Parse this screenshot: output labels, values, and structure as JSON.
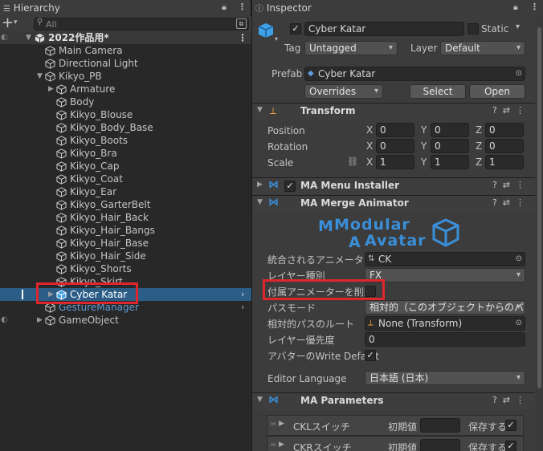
{
  "hierarchy": {
    "tab_label": "Hierarchy",
    "search_placeholder": "All",
    "scene_name": "2022作品用*",
    "items": [
      {
        "label": "Main Camera"
      },
      {
        "label": "Directional Light"
      },
      {
        "label": "Kikyo_PB"
      },
      {
        "label": "Armature"
      },
      {
        "label": "Body"
      },
      {
        "label": "Kikyo_Blouse"
      },
      {
        "label": "Kikyo_Body_Base"
      },
      {
        "label": "Kikyo_Boots"
      },
      {
        "label": "Kikyo_Bra"
      },
      {
        "label": "Kikyo_Cap"
      },
      {
        "label": "Kikyo_Coat"
      },
      {
        "label": "Kikyo_Ear"
      },
      {
        "label": "Kikyo_GarterBelt"
      },
      {
        "label": "Kikyo_Hair_Back"
      },
      {
        "label": "Kikyo_Hair_Bangs"
      },
      {
        "label": "Kikyo_Hair_Base"
      },
      {
        "label": "Kikyo_Hair_Side"
      },
      {
        "label": "Kikyo_Shorts"
      },
      {
        "label": "Kikyo_Skirt"
      },
      {
        "label": "Cyber Katar"
      },
      {
        "label": "GestureManager"
      },
      {
        "label": "GameObject"
      }
    ]
  },
  "inspector": {
    "tab_label": "Inspector",
    "object_name": "Cyber Katar",
    "static_label": "Static",
    "tag_label": "Tag",
    "tag_value": "Untagged",
    "layer_label": "Layer",
    "layer_value": "Default",
    "prefab_label": "Prefab",
    "prefab_value": "Cyber Katar",
    "overrides_label": "Overrides",
    "select_label": "Select",
    "open_label": "Open",
    "transform": {
      "title": "Transform",
      "position_label": "Position",
      "rotation_label": "Rotation",
      "scale_label": "Scale",
      "position": {
        "x": "0",
        "y": "0",
        "z": "0"
      },
      "rotation": {
        "x": "0",
        "y": "0",
        "z": "0"
      },
      "scale": {
        "x": "1",
        "y": "1",
        "z": "1"
      },
      "axis_x": "X",
      "axis_y": "Y",
      "axis_z": "Z"
    },
    "menu_installer": {
      "title": "MA Menu Installer"
    },
    "merge_animator": {
      "title": "MA Merge Animator",
      "logo_line1": "Modular",
      "logo_line2": "Avatar",
      "animator_label": "統合されるアニメーター",
      "animator_value": "CK",
      "layer_type_label": "レイヤー種別",
      "layer_type_value": "FX",
      "delete_attached_label": "付属アニメーターを削除",
      "path_mode_label": "パスモード",
      "path_mode_value": "相対的（このオブジェクトからのパスを依存",
      "relative_root_label": "相対的パスのルート",
      "relative_root_value": "None (Transform)",
      "layer_priority_label": "レイヤー優先度",
      "layer_priority_value": "0",
      "write_defaults_label": "アバターのWrite Default",
      "editor_language_label": "Editor Language",
      "editor_language_value": "日本語 (日本)"
    },
    "parameters": {
      "title": "MA Parameters",
      "rows": [
        {
          "name": "CKLスイッチ",
          "default_label": "初期値",
          "saved_label": "保存する"
        },
        {
          "name": "CKRスイッチ",
          "default_label": "初期値",
          "saved_label": "保存する"
        }
      ]
    }
  },
  "colors": {
    "selection": "#2c5d87",
    "highlight_box": "#e0262d",
    "ma_icon": "#3a8fd8",
    "prefab_blue": "#5f9bd8"
  }
}
